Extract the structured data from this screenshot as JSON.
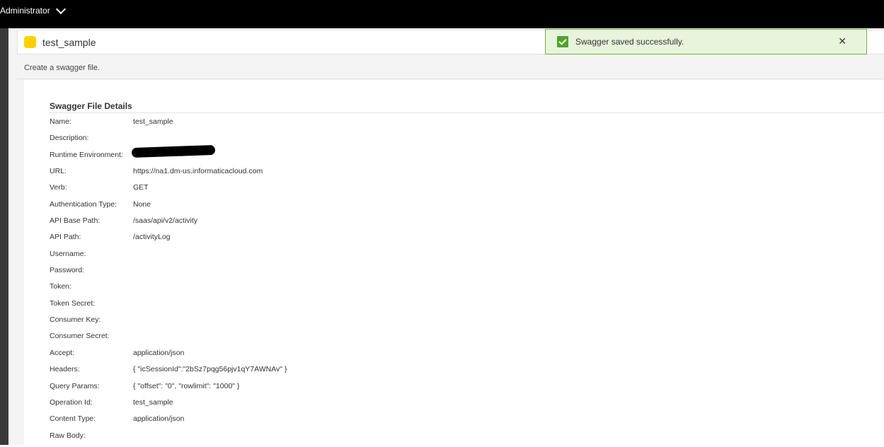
{
  "topbar": {
    "user_label": "Administrator",
    "chevron_icon": "chevron-down-icon"
  },
  "title": {
    "asset_icon": "swagger-asset-icon",
    "asset_icon_color": "#ffd000",
    "name": "test_sample"
  },
  "subtitle": "Create a swagger file.",
  "toast": {
    "icon": "check-icon",
    "message": "Swagger saved successfully.",
    "close_icon": "close-icon",
    "accent": "#4fa42b",
    "background": "#e8f4dc"
  },
  "details": {
    "title": "Swagger File Details",
    "fields": [
      {
        "label": "Name:",
        "value": "test_sample"
      },
      {
        "label": "Description:",
        "value": ""
      },
      {
        "label": "Runtime Environment:",
        "value": ""
      },
      {
        "label": "URL:",
        "value": "https://na1.dm-us.informaticacloud.com"
      },
      {
        "label": "Verb:",
        "value": "GET"
      },
      {
        "label": "Authentication Type:",
        "value": "None"
      },
      {
        "label": "API Base Path:",
        "value": "/saas/api/v2/activity"
      },
      {
        "label": "API Path:",
        "value": "/activityLog"
      },
      {
        "label": "Username:",
        "value": ""
      },
      {
        "label": "Password:",
        "value": ""
      },
      {
        "label": "Token:",
        "value": ""
      },
      {
        "label": "Token Secret:",
        "value": ""
      },
      {
        "label": "Consumer Key:",
        "value": ""
      },
      {
        "label": "Consumer Secret:",
        "value": ""
      },
      {
        "label": "Accept:",
        "value": "application/json"
      },
      {
        "label": "Headers:",
        "value": "{ \"icSessionId\":\"2bSz7pqg56pjv1qY7AWNAv\" }"
      },
      {
        "label": "Query Params:",
        "value": "{ \"offset\": \"0\", \"rowlimit\": \"1000\" }"
      },
      {
        "label": "Operation Id:",
        "value": "test_sample"
      },
      {
        "label": "Content Type:",
        "value": "application/json"
      },
      {
        "label": "Raw Body:",
        "value": ""
      }
    ]
  }
}
